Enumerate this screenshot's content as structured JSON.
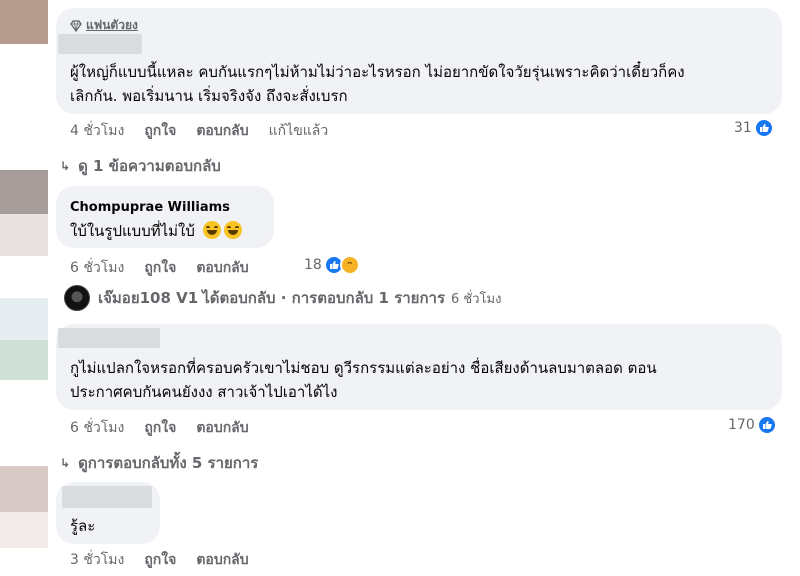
{
  "comments": [
    {
      "badge": "แฟนตัวยง",
      "text_line1": "ผู้ใหญ่ก็แบบนี้แหละ คบกันแรกๆไม่ห้ามไม่ว่าอะไรหรอก ไม่อยากขัดใจวัยรุ่นเพราะคิดว่าเดี๋ยวก็คง",
      "text_line2": "เลิกกัน. พอเริ่มนาน เริ่มจริงจัง ถึงจะสั่งเบรก",
      "time": "4 ชั่วโมง",
      "like": "ถูกใจ",
      "reply": "ตอบกลับ",
      "edited": "แก้ไขแล้ว",
      "reaction_count": "31"
    },
    {
      "author": "Chompuprae Williams",
      "text": "ใบ้ในรูปแบบที่ไม่ใบ้",
      "time": "6 ชั่วโมง",
      "like": "ถูกใจ",
      "reply": "ตอบกลับ",
      "reaction_count": "18"
    },
    {
      "text_line1": "กูไม่แปลกใจหรอกที่ครอบครัวเขาไม่ชอบ ดูวีรกรรมแต่ละอย่าง ชื่อเสียงด้านลบมาตลอด ตอน",
      "text_line2": "ประกาศคบกันคนยังงง สาวเจ้าไปเอาได้ไง",
      "time": "6 ชั่วโมง",
      "like": "ถูกใจ",
      "reply": "ตอบกลับ",
      "reaction_count": "170"
    },
    {
      "text": "รู้ละ",
      "time": "3 ชั่วโมง",
      "like": "ถูกใจ",
      "reply": "ตอบกลับ"
    }
  ],
  "view_replies_1": "ดู 1 ข้อความตอบกลับ",
  "replier": {
    "name": "เจ๊มอย108 V1",
    "action": "ได้ตอบกลับ · การตอบกลับ 1 รายการ",
    "time": "6 ชั่วโมง"
  },
  "view_replies_2": "ดูการตอบกลับทั้ง 5 รายการ",
  "colors": {
    "bubble": "#f0f2f5",
    "meta_text": "#65676b",
    "like_blue": "#1877f2",
    "haha_yellow": "#f7b125"
  },
  "icons": [
    "diamond-icon",
    "like-reaction-icon",
    "haha-reaction-icon",
    "laughing-emoji-icon",
    "chevron-arrow-icon"
  ]
}
